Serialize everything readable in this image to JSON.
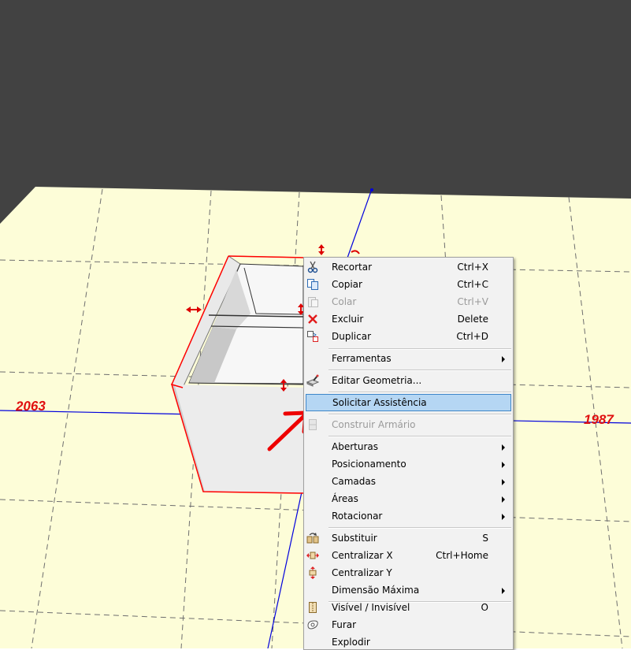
{
  "dimensions": {
    "left": "2063",
    "right": "1987"
  },
  "context_menu": {
    "items": [
      {
        "id": "recortar",
        "label": "Recortar",
        "shortcut": "Ctrl+X",
        "icon": "scissors-icon",
        "disabled": false
      },
      {
        "id": "copiar",
        "label": "Copiar",
        "shortcut": "Ctrl+C",
        "icon": "copy-icon",
        "disabled": false
      },
      {
        "id": "colar",
        "label": "Colar",
        "shortcut": "Ctrl+V",
        "icon": "paste-icon",
        "disabled": true
      },
      {
        "id": "excluir",
        "label": "Excluir",
        "shortcut": "Delete",
        "icon": "delete-x-icon",
        "disabled": false
      },
      {
        "id": "duplicar",
        "label": "Duplicar",
        "shortcut": "Ctrl+D",
        "icon": "duplicate-icon",
        "disabled": false
      },
      {
        "id": "ferramentas",
        "label": "Ferramentas",
        "submenu": true
      },
      {
        "id": "editar-geometria",
        "label": "Editar Geometria...",
        "icon": "edit-geometry-icon"
      },
      {
        "id": "solicitar-assistencia",
        "label": "Solicitar Assistência",
        "highlighted": true
      },
      {
        "id": "construir-armario",
        "label": "Construir Armário",
        "icon": "cabinet-icon",
        "disabled": true
      },
      {
        "id": "aberturas",
        "label": "Aberturas",
        "submenu": true
      },
      {
        "id": "posicionamento",
        "label": "Posicionamento",
        "submenu": true
      },
      {
        "id": "camadas",
        "label": "Camadas",
        "submenu": true
      },
      {
        "id": "areas",
        "label": "Áreas",
        "submenu": true
      },
      {
        "id": "rotacionar",
        "label": "Rotacionar",
        "submenu": true
      },
      {
        "id": "substituir",
        "label": "Substituir",
        "shortcut": "S",
        "icon": "replace-icon"
      },
      {
        "id": "centralizar-x",
        "label": "Centralizar X",
        "shortcut": "Ctrl+Home",
        "icon": "center-x-icon"
      },
      {
        "id": "centralizar-y",
        "label": "Centralizar Y",
        "icon": "center-y-icon"
      },
      {
        "id": "dimensao-maxima",
        "label": "Dimensão Máxima",
        "submenu": true
      },
      {
        "id": "visivel-invisivel",
        "label": "Visível / Invisível",
        "shortcut": "O",
        "icon": "visibility-icon"
      },
      {
        "id": "furar",
        "label": "Furar",
        "icon": "drill-icon"
      },
      {
        "id": "explodir",
        "label": "Explodir"
      }
    ]
  },
  "colors": {
    "background": "#424242",
    "floor": "#fdfdd8",
    "highlight": "#b5d6f3",
    "highlight_border": "#3d86c9",
    "dimension_text": "#e01010",
    "axis": "#0000dd"
  }
}
